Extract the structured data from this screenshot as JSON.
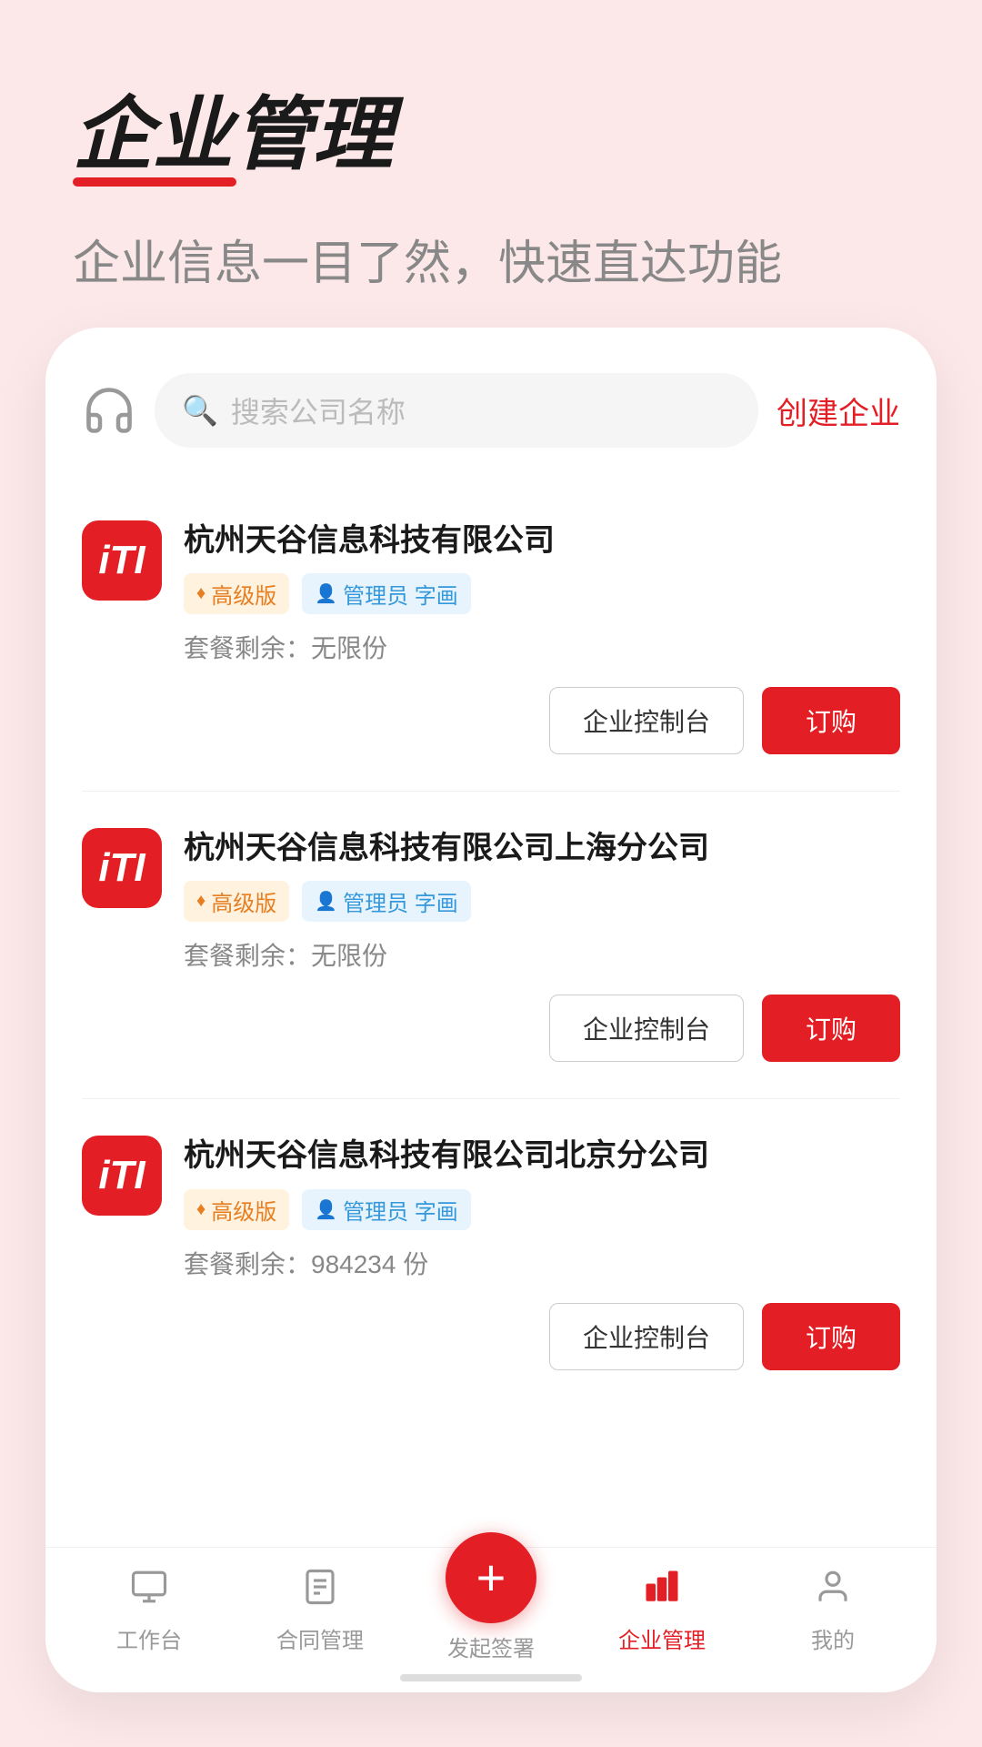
{
  "header": {
    "title": "企业管理",
    "subtitle": "企业信息一目了然，快速直达功能"
  },
  "search": {
    "placeholder": "搜索公司名称",
    "create_label": "创建企业"
  },
  "companies": [
    {
      "id": 1,
      "name": "杭州天谷信息科技有限公司",
      "logo_text": "iTI",
      "tier": "高级版",
      "role": "管理员 字画",
      "quota_label": "套餐剩余：",
      "quota_value": "无限份",
      "btn_control": "企业控制台",
      "btn_order": "订购"
    },
    {
      "id": 2,
      "name": "杭州天谷信息科技有限公司上海分公司",
      "logo_text": "iTI",
      "tier": "高级版",
      "role": "管理员 字画",
      "quota_label": "套餐剩余：",
      "quota_value": "无限份",
      "btn_control": "企业控制台",
      "btn_order": "订购"
    },
    {
      "id": 3,
      "name": "杭州天谷信息科技有限公司北京分公司",
      "logo_text": "iTI",
      "tier": "高级版",
      "role": "管理员 字画",
      "quota_label": "套餐剩余：",
      "quota_value": "984234 份",
      "btn_control": "企业控制台",
      "btn_order": "订购"
    }
  ],
  "nav": {
    "items": [
      {
        "id": "workspace",
        "label": "工作台",
        "icon": "□",
        "active": false
      },
      {
        "id": "contract",
        "label": "合同管理",
        "icon": "≡",
        "active": false
      },
      {
        "id": "sign",
        "label": "发起签署",
        "icon": "+",
        "active": false,
        "fab": true
      },
      {
        "id": "enterprise",
        "label": "企业管理",
        "icon": "📊",
        "active": true
      },
      {
        "id": "mine",
        "label": "我的",
        "icon": "✓",
        "active": false
      }
    ]
  }
}
